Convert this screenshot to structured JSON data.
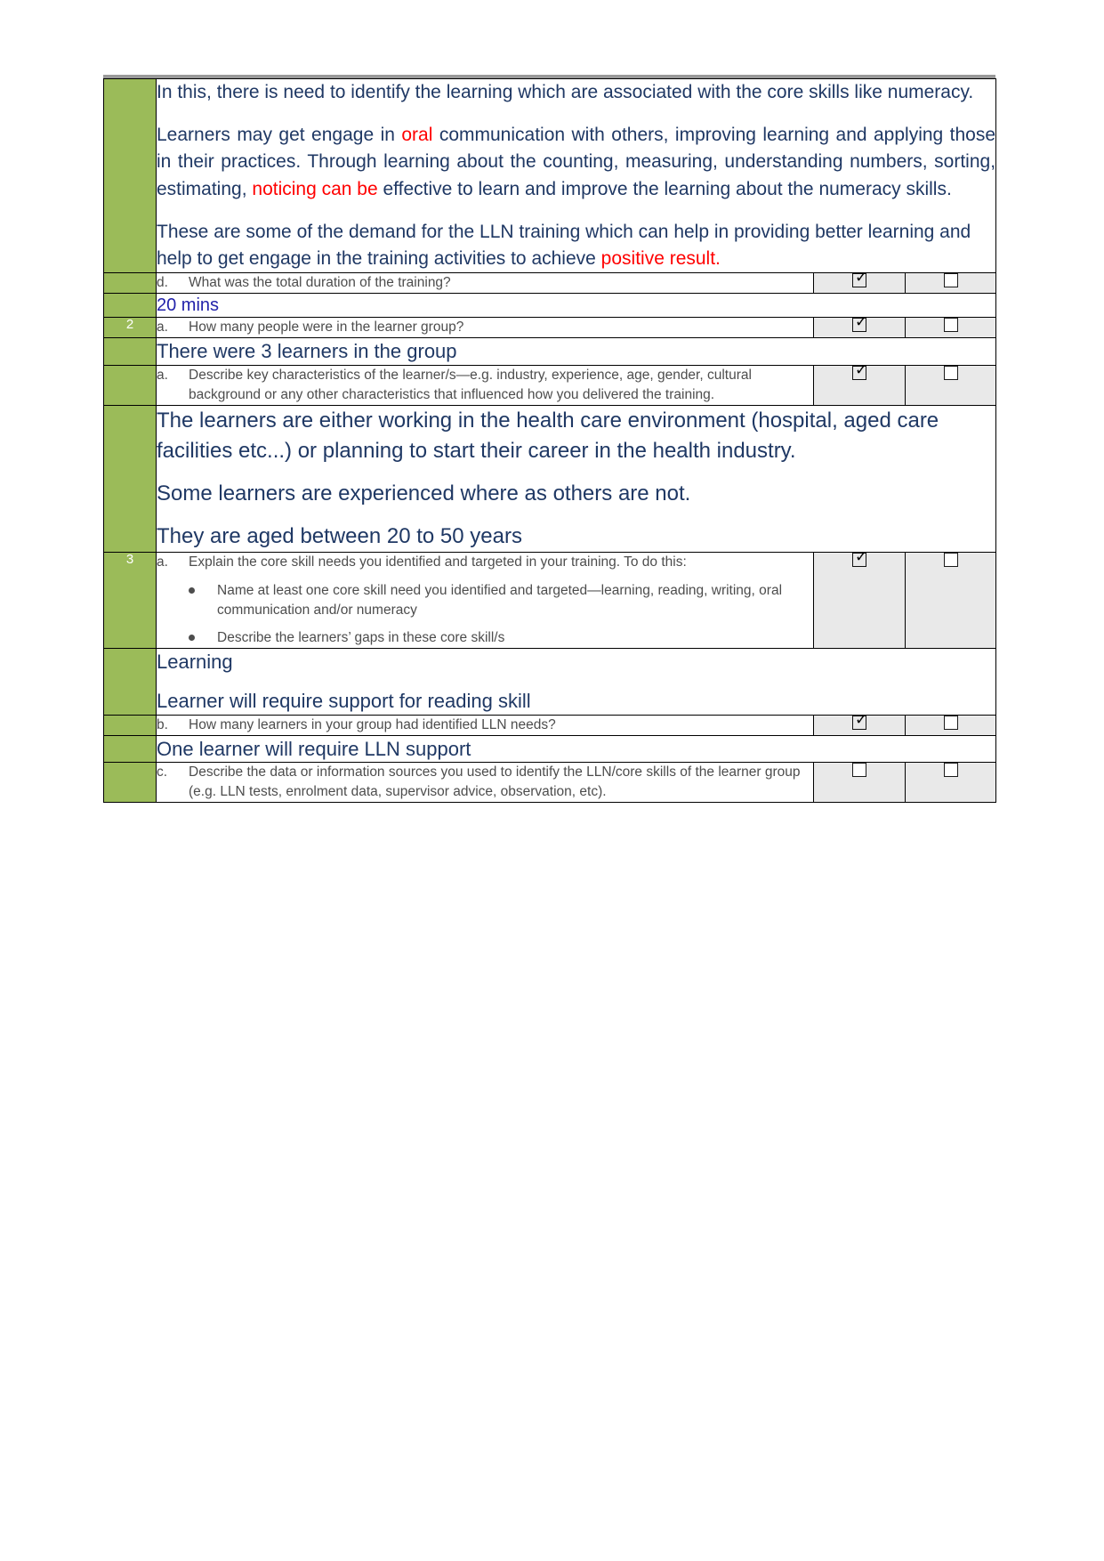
{
  "document": {
    "type": "assessment-form",
    "colors": {
      "green_sidebar": "#9bbb59",
      "answer_navy": "#1f3864",
      "highlight_red": "#ff0000",
      "checkbox_cell_grey": "#e9e9e9"
    }
  },
  "intro_answer": {
    "paragraph1": "In this, there is need to identify the learning which are associated with the core skills like numeracy.",
    "paragraph2_part1": "Learners may get engage in ",
    "paragraph2_red1": "oral",
    "paragraph2_part2": " communication with others, improving learning and applying those in their practices. Through learning about the counting, measuring, understanding numbers, sorting, estimating, ",
    "paragraph2_red2": "noticing can be",
    "paragraph2_part3": " effective to learn and improve the learning about the numeracy skills.",
    "paragraph3_part1": "These are some of the demand for the LLN training which can help in providing better learning and help to get engage in the training activities to achieve ",
    "paragraph3_red": "positive result."
  },
  "rows": [
    {
      "number": "",
      "label": "d.",
      "question": "What was the total duration of the training?",
      "checkbox_left": "checked",
      "checkbox_right": "unchecked",
      "answer": "20 mins"
    },
    {
      "number": "2",
      "label": "a.",
      "question": "How many people were in the learner group?",
      "checkbox_left": "checked",
      "checkbox_right": "unchecked",
      "answer": "There were 3 learners in the group"
    },
    {
      "number": "",
      "label": "a.",
      "question": "Describe key characteristics of the learner/s—e.g. industry, experience, age, gender, cultural background or any other characteristics that influenced how you delivered the training.",
      "checkbox_left": "checked",
      "checkbox_right": "unchecked",
      "answer_line1": "The learners are either working in the health care environment (hospital, aged care facilities etc...) or planning to start their career in the health industry.",
      "answer_line2": "Some learners are experienced where as others are not.",
      "answer_line3": "They are aged between 20 to 50 years"
    },
    {
      "number": "3",
      "label": "a.",
      "question": "Explain the core skill needs you identified and targeted in your training. To do this:",
      "bullets": [
        "Name at least one core skill need you identified and targeted—learning, reading, writing, oral communication and/or numeracy",
        "Describe the learners’ gaps in these core skill/s"
      ],
      "checkbox_left": "checked",
      "checkbox_right": "unchecked",
      "answer_line1": "Learning",
      "answer_line2": "Learner will require support for reading skill"
    },
    {
      "number": "",
      "label": "b.",
      "question": "How many learners in your group had identified LLN needs?",
      "checkbox_left": "checked",
      "checkbox_right": "unchecked",
      "answer": "One learner will require LLN support"
    },
    {
      "number": "",
      "label": "c.",
      "question": "Describe the data or information sources you used to identify the LLN/core skills of the learner group (e.g. LLN tests, enrolment data, supervisor advice, observation, etc).",
      "checkbox_left": "unchecked",
      "checkbox_right": "unchecked"
    }
  ],
  "icons": {
    "checked": "☑",
    "unchecked": "☐",
    "bullet": "●"
  }
}
